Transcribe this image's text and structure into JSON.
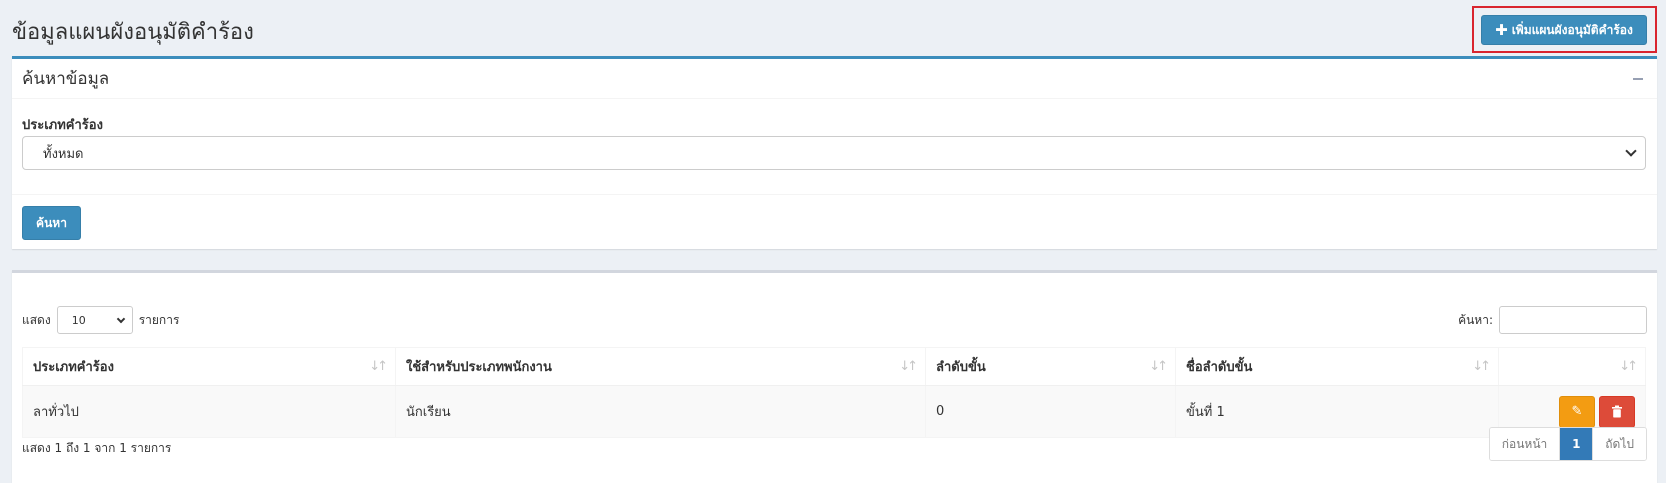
{
  "page": {
    "title": "ข้อมูลแผนผังอนุมัติคำร้อง"
  },
  "header": {
    "add_button_label": "เพิ่มแผนผังอนุมัติคำร้อง",
    "add_icon": "plus-icon"
  },
  "search": {
    "title": "ค้นหาข้อมูล",
    "field_label": "ประเภทคำร้อง",
    "selected_value": "ทั้งหมด",
    "button_label": "ค้นหา"
  },
  "table": {
    "length_prefix": "แสดง",
    "length_value": "10",
    "length_suffix": "รายการ",
    "filter_label": "ค้นหา:",
    "columns": [
      "ประเภทคำร้อง",
      "ใช้สำหรับประเภทพนักงาน",
      "ลำดับขั้น",
      "ชื่อลำดับขั้น",
      ""
    ],
    "rows": [
      {
        "type": "ลาทั่วไป",
        "employee_type": "นักเรียน",
        "order": "0",
        "order_name": "ขั้นที่ 1"
      }
    ],
    "info": "แสดง 1 ถึง 1 จาก 1 รายการ",
    "pagination": {
      "prev": "ก่อนหน้า",
      "current": "1",
      "next": "ถัดไป"
    }
  },
  "colors": {
    "primary": "#3c8dbc",
    "warning": "#f39c12",
    "danger": "#dd4b39",
    "highlight": "#d9252e"
  }
}
